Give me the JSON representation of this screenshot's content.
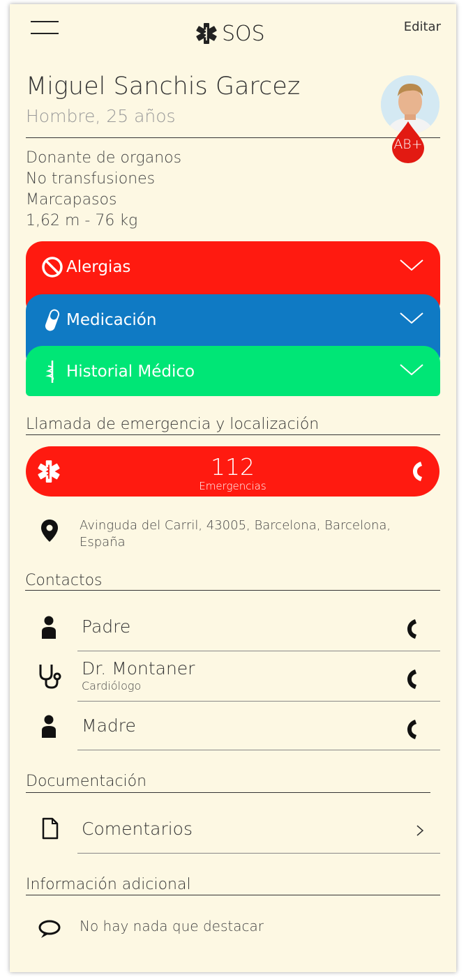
{
  "header": {
    "title": "SOS",
    "edit_label": "Editar"
  },
  "profile": {
    "name": "Miguel Sanchis Garcez",
    "subtitle": "Hombre, 25 años",
    "blood_type": "AB+",
    "info": [
      "Donante de organos",
      "No transfusiones",
      "Marcapasos",
      "1,62 m - 76 kg"
    ]
  },
  "sections_acc": [
    {
      "label": "Alergias",
      "color": "#ff1a10",
      "icon": "prohibited-icon"
    },
    {
      "label": "Medicación",
      "color": "#0f7ac4",
      "icon": "pill-icon"
    },
    {
      "label": "Historial Médico",
      "color": "#00e676",
      "icon": "caduceus-icon"
    }
  ],
  "emergency": {
    "heading": "Llamada de emergencia y localización",
    "number": "112",
    "label": "Emergencias",
    "address": "Avinguda del Carril, 43005, Barcelona, Barcelona, España"
  },
  "contacts": {
    "heading": "Contactos",
    "items": [
      {
        "name": "Padre",
        "role": "",
        "icon": "person-icon"
      },
      {
        "name": "Dr. Montaner",
        "role": "Cardiólogo",
        "icon": "stethoscope-icon"
      },
      {
        "name": "Madre",
        "role": "",
        "icon": "person-icon"
      }
    ]
  },
  "documentation": {
    "heading": "Documentación",
    "item": "Comentarios"
  },
  "additional": {
    "heading": "Información adicional",
    "text": "No hay nada que destacar"
  },
  "colors": {
    "background": "#fdf8e3",
    "red": "#ff1a10",
    "blue": "#0f7ac4",
    "green": "#00e676"
  }
}
